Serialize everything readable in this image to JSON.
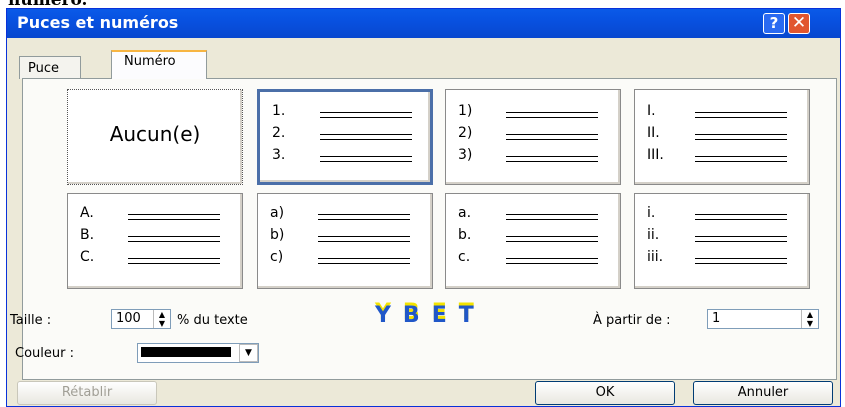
{
  "background_text": "numéro.",
  "window": {
    "title": "Puces et numéros",
    "help_glyph": "?",
    "close_glyph": "✕"
  },
  "tabs": [
    {
      "label": "Puce"
    },
    {
      "label": "Numéro"
    }
  ],
  "styles": [
    {
      "title": "Aucun(e)"
    },
    {
      "labels": [
        "1.",
        "2.",
        "3."
      ]
    },
    {
      "labels": [
        "1)",
        "2)",
        "3)"
      ]
    },
    {
      "labels": [
        "I.",
        "II.",
        "III."
      ]
    },
    {
      "labels": [
        "A.",
        "B.",
        "C."
      ]
    },
    {
      "labels": [
        "a)",
        "b)",
        "c)"
      ]
    },
    {
      "labels": [
        "a.",
        "b.",
        "c."
      ]
    },
    {
      "labels": [
        "i.",
        "ii.",
        "iii."
      ]
    }
  ],
  "size": {
    "label": "Taille :",
    "value": "100",
    "suffix": "% du texte"
  },
  "start": {
    "label": "À partir de :",
    "value": "1"
  },
  "color": {
    "label": "Couleur :",
    "value": "#000000"
  },
  "watermark": "YBET",
  "buttons": {
    "reset": "Rétablir",
    "ok": "OK",
    "cancel": "Annuler"
  }
}
